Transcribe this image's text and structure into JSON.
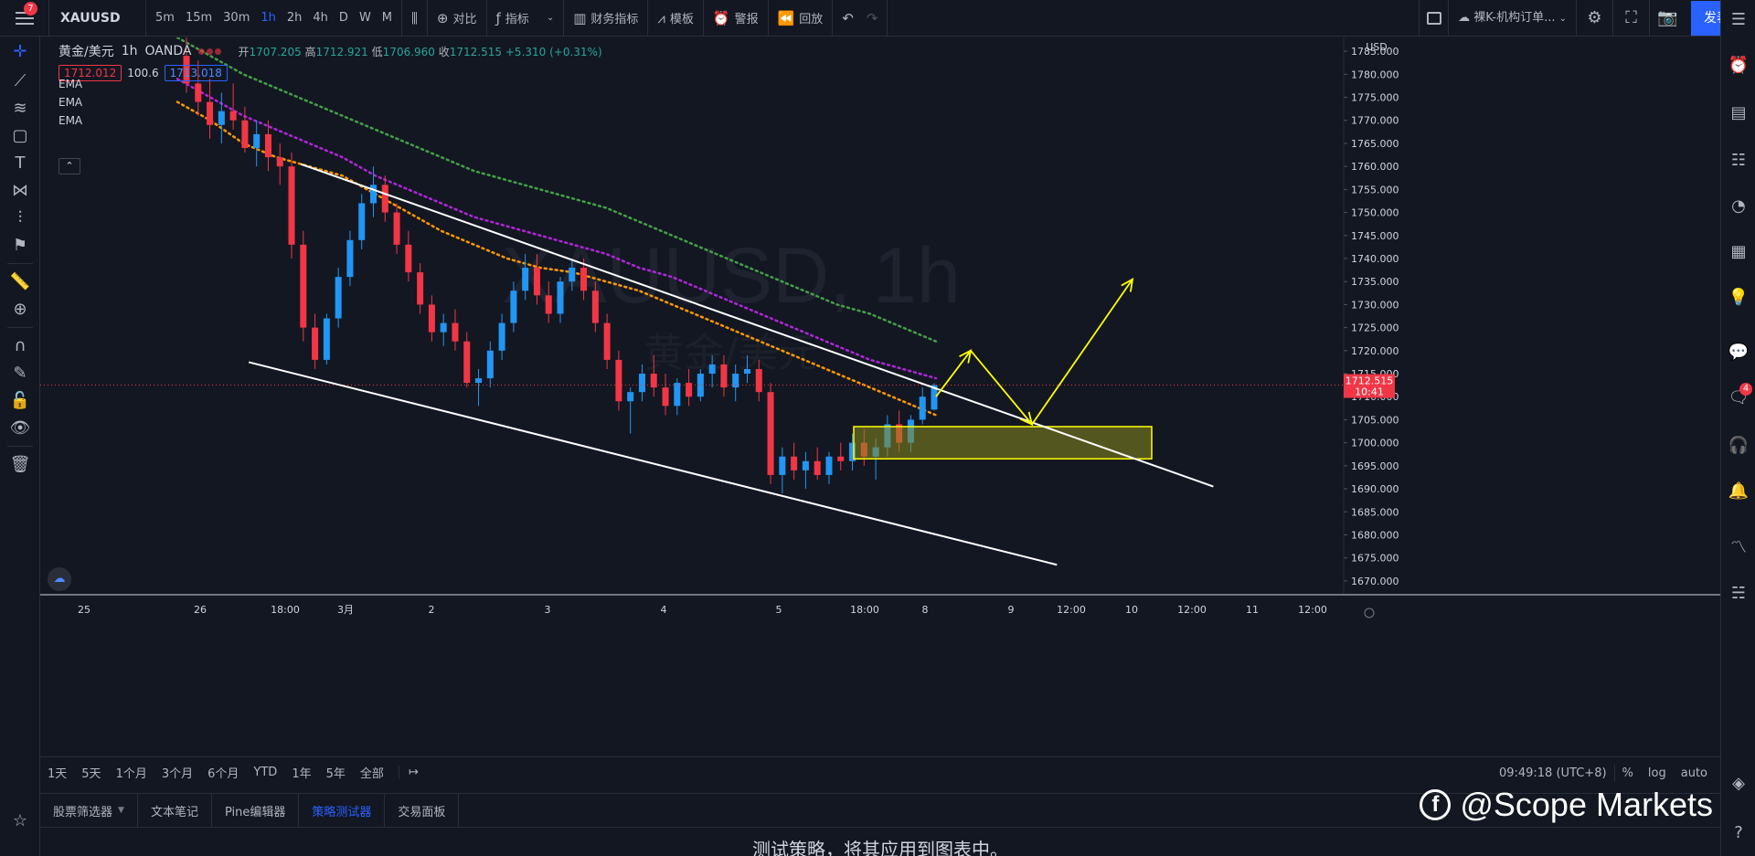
{
  "toolbar": {
    "badge": "7",
    "symbol": "XAUUSD",
    "intervals": [
      "5m",
      "15m",
      "30m",
      "1h",
      "2h",
      "4h",
      "D",
      "W",
      "M"
    ],
    "active_interval": "1h",
    "compare": "对比",
    "indicators": "指标",
    "financials": "财务指标",
    "templates": "模板",
    "alert": "警报",
    "replay": "回放",
    "layout_name": "裸K-机构订单...",
    "publish": "发表"
  },
  "legend": {
    "title": "黄金/美元",
    "interval": "1h",
    "source": "OANDA",
    "open_label": "开",
    "open": "1707.205",
    "high_label": "高",
    "high": "1712.921",
    "low_label": "低",
    "low": "1706.960",
    "close_label": "收",
    "close": "1712.515",
    "change": "+5.310 (+0.31%)",
    "bid": "1712.012",
    "spread": "100.6",
    "ask": "1713.018",
    "ema_labels": [
      "EMA",
      "EMA",
      "EMA"
    ]
  },
  "price_scale": {
    "currency": "USD",
    "current_price": "1712.515",
    "countdown": "10:41"
  },
  "watermark": {
    "symbol_interval": "XAUUSD, 1h",
    "name": "黄金/美元"
  },
  "chart_data": {
    "type": "candlestick",
    "title": "",
    "ylim": [
      1667,
      1788
    ],
    "y_ticks": [
      1785,
      1780,
      1775,
      1770,
      1765,
      1760,
      1755,
      1750,
      1745,
      1740,
      1735,
      1730,
      1725,
      1720,
      1715,
      1710,
      1705,
      1700,
      1695,
      1690,
      1685,
      1680,
      1675,
      1670
    ],
    "x_ticks": [
      "25",
      "26",
      "18:00",
      "3月",
      "2",
      "3",
      "4",
      "5",
      "18:00",
      "8",
      "9",
      "12:00",
      "10",
      "12:00",
      "11",
      "12:00"
    ],
    "current_price": 1712.515,
    "candles": [
      [
        1784,
        1788,
        1776,
        1778
      ],
      [
        1778,
        1783,
        1771,
        1774
      ],
      [
        1774,
        1779,
        1766,
        1769
      ],
      [
        1769,
        1776,
        1765,
        1772
      ],
      [
        1772,
        1778,
        1768,
        1770
      ],
      [
        1770,
        1773,
        1763,
        1764
      ],
      [
        1764,
        1770,
        1760,
        1767
      ],
      [
        1767,
        1770,
        1759,
        1762
      ],
      [
        1762,
        1765,
        1756,
        1760
      ],
      [
        1760,
        1763,
        1740,
        1743
      ],
      [
        1743,
        1746,
        1722,
        1725
      ],
      [
        1725,
        1728,
        1716,
        1718
      ],
      [
        1718,
        1728,
        1717,
        1727
      ],
      [
        1727,
        1738,
        1725,
        1736
      ],
      [
        1736,
        1746,
        1734,
        1744
      ],
      [
        1744,
        1754,
        1742,
        1752
      ],
      [
        1752,
        1760,
        1749,
        1756
      ],
      [
        1756,
        1758,
        1748,
        1750
      ],
      [
        1750,
        1752,
        1741,
        1743
      ],
      [
        1743,
        1746,
        1735,
        1737
      ],
      [
        1737,
        1739,
        1728,
        1730
      ],
      [
        1730,
        1732,
        1722,
        1724
      ],
      [
        1724,
        1728,
        1721,
        1726
      ],
      [
        1726,
        1729,
        1720,
        1722
      ],
      [
        1722,
        1724,
        1712,
        1713
      ],
      [
        1713,
        1716,
        1708,
        1714
      ],
      [
        1714,
        1722,
        1712,
        1720
      ],
      [
        1720,
        1728,
        1718,
        1726
      ],
      [
        1726,
        1735,
        1724,
        1733
      ],
      [
        1733,
        1741,
        1731,
        1738
      ],
      [
        1738,
        1741,
        1730,
        1732
      ],
      [
        1732,
        1735,
        1726,
        1728
      ],
      [
        1728,
        1736,
        1726,
        1735
      ],
      [
        1735,
        1740,
        1733,
        1738
      ],
      [
        1738,
        1740,
        1731,
        1733
      ],
      [
        1733,
        1735,
        1724,
        1726
      ],
      [
        1726,
        1728,
        1716,
        1718
      ],
      [
        1718,
        1720,
        1707,
        1709
      ],
      [
        1709,
        1712,
        1702,
        1711
      ],
      [
        1711,
        1717,
        1709,
        1715
      ],
      [
        1715,
        1719,
        1710,
        1712
      ],
      [
        1712,
        1715,
        1706,
        1708
      ],
      [
        1708,
        1714,
        1706,
        1713
      ],
      [
        1713,
        1716,
        1708,
        1710
      ],
      [
        1710,
        1716,
        1709,
        1715
      ],
      [
        1715,
        1719,
        1712,
        1717
      ],
      [
        1717,
        1719,
        1710,
        1712
      ],
      [
        1712,
        1717,
        1709,
        1715
      ],
      [
        1715,
        1719,
        1713,
        1716
      ],
      [
        1716,
        1718,
        1709,
        1711
      ],
      [
        1711,
        1713,
        1691,
        1693
      ],
      [
        1693,
        1699,
        1689,
        1697
      ],
      [
        1697,
        1700,
        1692,
        1694
      ],
      [
        1694,
        1698,
        1690,
        1696
      ],
      [
        1696,
        1699,
        1692,
        1693
      ],
      [
        1693,
        1698,
        1691,
        1697
      ],
      [
        1697,
        1700,
        1694,
        1696
      ],
      [
        1696,
        1702,
        1694,
        1700
      ],
      [
        1700,
        1703,
        1695,
        1697
      ],
      [
        1697,
        1701,
        1692,
        1699
      ],
      [
        1699,
        1706,
        1697,
        1704
      ],
      [
        1704,
        1707,
        1698,
        1700
      ],
      [
        1700,
        1706,
        1698,
        1705
      ],
      [
        1705,
        1712,
        1704,
        1710
      ],
      [
        1707.205,
        1712.921,
        1706.96,
        1712.515
      ]
    ],
    "ema_lines": [
      {
        "color": "#ff9800",
        "values": [
          1774,
          1770,
          1765,
          1762,
          1760,
          1758,
          1754,
          1750,
          1746,
          1743,
          1740,
          1738,
          1737,
          1735,
          1733,
          1730,
          1727,
          1724,
          1721,
          1718,
          1715,
          1712,
          1709,
          1706
        ]
      },
      {
        "color": "#b026d9",
        "values": [
          1779,
          1775,
          1771,
          1768,
          1765,
          1762,
          1758,
          1755,
          1752,
          1749,
          1747,
          1745,
          1743,
          1741,
          1738,
          1736,
          1733,
          1730,
          1727,
          1724,
          1721,
          1718,
          1716,
          1714
        ]
      },
      {
        "color": "#43a047",
        "values": [
          1788,
          1784,
          1780,
          1777,
          1774,
          1771,
          1768,
          1765,
          1762,
          1759,
          1757,
          1755,
          1753,
          1751,
          1748,
          1745,
          1742,
          1739,
          1736,
          1733,
          1730,
          1728,
          1725,
          1722
        ]
      }
    ],
    "annotations": {
      "trendline_upper": [
        [
          1760.5,
          0.2
        ],
        [
          1690.5,
          0.9
        ]
      ],
      "trendline_lower": [
        [
          1717.5,
          0.16
        ],
        [
          1673.5,
          0.78
        ]
      ],
      "zone": {
        "top": 1703.5,
        "bottom": 1696.5
      }
    }
  },
  "range_bar": {
    "ranges": [
      "1天",
      "5天",
      "1个月",
      "3个月",
      "6个月",
      "YTD",
      "1年",
      "5年",
      "全部"
    ],
    "time": "09:49:18 (UTC+8)",
    "percent": "%",
    "log": "log",
    "auto": "auto"
  },
  "panel_tabs": [
    {
      "label": "股票筛选器",
      "caret": true
    },
    {
      "label": "文本笔记",
      "caret": false
    },
    {
      "label": "Pine编辑器",
      "caret": false
    },
    {
      "label": "策略测试器",
      "caret": false,
      "active": true
    },
    {
      "label": "交易面板",
      "caret": false
    }
  ],
  "panel_message": "测试策略，将其应用到图表中。",
  "brand_watermark": "@Scope Markets",
  "right_badge": "4",
  "colors": {
    "up": "#2196f3",
    "down": "#f23645",
    "accent": "#2962ff",
    "zone_fill": "#8a8a1e",
    "zone_stroke": "#ffff00",
    "trend": "#ffffff",
    "projection": "#ffff00"
  }
}
